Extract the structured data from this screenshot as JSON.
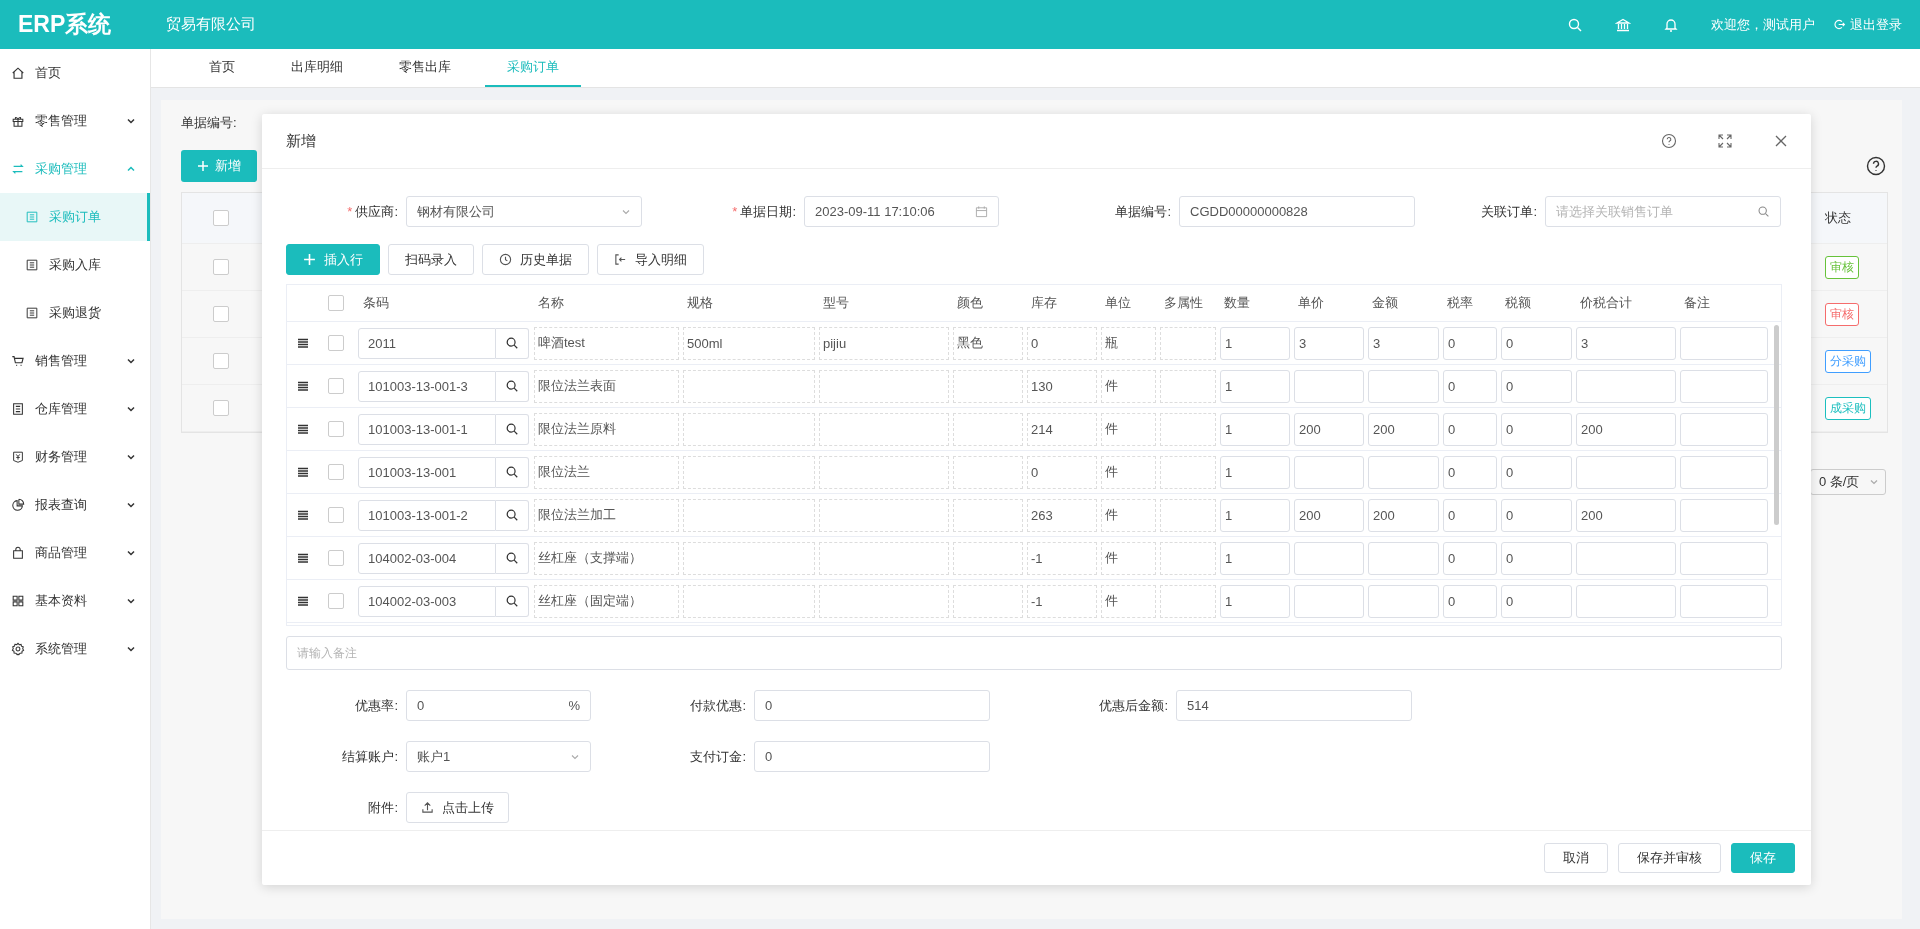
{
  "header": {
    "logo": "ERP系统",
    "company": "贸易有限公司",
    "welcome": "欢迎您，测试用户",
    "logout": "退出登录"
  },
  "sidebar": {
    "items": [
      {
        "label": "首页",
        "selected": false
      },
      {
        "label": "零售管理",
        "selected": false,
        "expanded": false
      },
      {
        "label": "采购管理",
        "selected": false,
        "expanded": true,
        "children": [
          {
            "label": "采购订单",
            "selected": true
          },
          {
            "label": "采购入库",
            "selected": false
          },
          {
            "label": "采购退货",
            "selected": false
          }
        ]
      },
      {
        "label": "销售管理",
        "selected": false,
        "expanded": false
      },
      {
        "label": "仓库管理",
        "selected": false,
        "expanded": false
      },
      {
        "label": "财务管理",
        "selected": false,
        "expanded": false
      },
      {
        "label": "报表查询",
        "selected": false,
        "expanded": false
      },
      {
        "label": "商品管理",
        "selected": false,
        "expanded": false
      },
      {
        "label": "基本资料",
        "selected": false,
        "expanded": false
      },
      {
        "label": "系统管理",
        "selected": false,
        "expanded": false
      }
    ]
  },
  "tabs": [
    {
      "label": "首页",
      "selected": false
    },
    {
      "label": "出库明细",
      "selected": false
    },
    {
      "label": "零售出库",
      "selected": false
    },
    {
      "label": "采购订单",
      "selected": true
    }
  ],
  "page": {
    "filter_label": "单据编号:",
    "add_button": "新增",
    "status_header": "状态",
    "all_checked": false,
    "rows": [
      {
        "checked": false,
        "status": "审核",
        "color": "#67c23a"
      },
      {
        "checked": false,
        "status": "审核",
        "color": "#f56c6c"
      },
      {
        "checked": false,
        "status": "分采购",
        "color": "#409eff"
      },
      {
        "checked": false,
        "status": "成采购",
        "color": "#1cbfbf"
      }
    ],
    "page_size": "0 条/页"
  },
  "dialog": {
    "title": "新增",
    "form": {
      "supplier_mark": "*",
      "date_mark": "*",
      "supplier_label": "供应商:",
      "supplier": "钢材有限公司",
      "date_label": "单据日期:",
      "date": "2023-09-11 17:10:06",
      "number_label": "单据编号:",
      "number": "CGDD00000000828",
      "link_label": "关联订单:",
      "link_placeholder": "请选择关联销售订单"
    },
    "toolbar": [
      "插入行",
      "扫码录入",
      "历史单据",
      "导入明细"
    ],
    "table": {
      "all_checked": false,
      "columns": [
        "条码",
        "名称",
        "规格",
        "型号",
        "颜色",
        "库存",
        "单位",
        "多属性",
        "数量",
        "单价",
        "金额",
        "税率",
        "税额",
        "价税合计",
        "备注"
      ],
      "rows": [
        {
          "checked": false,
          "barcode": "2011",
          "name": "啤酒test",
          "spec": "500ml",
          "model": "pijiu",
          "shade": "黑色",
          "stock": "0",
          "unit": "瓶",
          "qty": "1",
          "price": "3",
          "amount": "3",
          "tax_rate": "0",
          "tax": "0",
          "total": "3"
        },
        {
          "checked": false,
          "barcode": "101003-13-001-3",
          "name": "限位法兰表面",
          "stock": "130",
          "unit": "件",
          "qty": "1",
          "tax_rate": "0",
          "tax": "0"
        },
        {
          "checked": false,
          "barcode": "101003-13-001-1",
          "name": "限位法兰原料",
          "stock": "214",
          "unit": "件",
          "qty": "1",
          "price": "200",
          "amount": "200",
          "tax_rate": "0",
          "tax": "0",
          "total": "200"
        },
        {
          "checked": false,
          "barcode": "101003-13-001",
          "name": "限位法兰",
          "stock": "0",
          "unit": "件",
          "qty": "1",
          "tax_rate": "0",
          "tax": "0"
        },
        {
          "checked": false,
          "barcode": "101003-13-001-2",
          "name": "限位法兰加工",
          "stock": "263",
          "unit": "件",
          "qty": "1",
          "price": "200",
          "amount": "200",
          "tax_rate": "0",
          "tax": "0",
          "total": "200"
        },
        {
          "checked": false,
          "barcode": "104002-03-004",
          "name": "丝杠座（支撑端）",
          "stock": "-1",
          "unit": "件",
          "qty": "1",
          "tax_rate": "0",
          "tax": "0"
        },
        {
          "checked": false,
          "barcode": "104002-03-003",
          "name": "丝杠座（固定端）",
          "stock": "-1",
          "unit": "件",
          "qty": "1",
          "tax_rate": "0",
          "tax": "0"
        }
      ]
    },
    "remark_placeholder": "请输入备注",
    "discount_label": "优惠率:",
    "discount": "0",
    "discount_unit": "%",
    "pay_discount_label": "付款优惠:",
    "pay_discount": "0",
    "after_label": "优惠后金额:",
    "after": "514",
    "account_label": "结算账户:",
    "account": "账户1",
    "deposit_label": "支付订金:",
    "deposit": "0",
    "attach_label": "附件:",
    "upload": "点击上传",
    "buttons": [
      "取消",
      "保存并审核",
      "保存"
    ]
  }
}
